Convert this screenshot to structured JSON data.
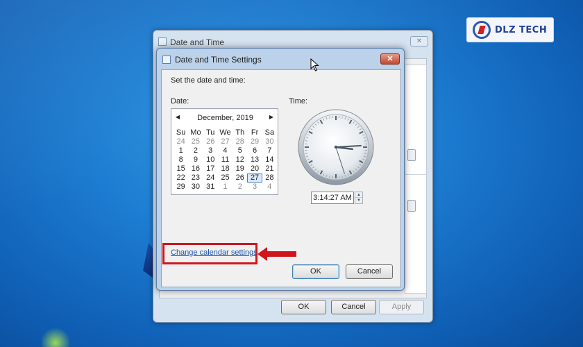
{
  "watermark": {
    "brand": "DLZ TECH"
  },
  "back_window": {
    "title": "Date and Time",
    "close_label": "✕",
    "ok_label": "OK",
    "cancel_label": "Cancel",
    "apply_label": "Apply"
  },
  "dialog": {
    "title": "Date and Time Settings",
    "close_label": "✕",
    "instruction": "Set the date and time:",
    "date_label": "Date:",
    "time_label": "Time:",
    "calendar": {
      "month_label": "December, 2019",
      "prev_icon": "◀",
      "next_icon": "▶",
      "weekdays": [
        "Su",
        "Mo",
        "Tu",
        "We",
        "Th",
        "Fr",
        "Sa"
      ],
      "days": [
        {
          "d": "24",
          "m": "other"
        },
        {
          "d": "25",
          "m": "other"
        },
        {
          "d": "26",
          "m": "other"
        },
        {
          "d": "27",
          "m": "other"
        },
        {
          "d": "28",
          "m": "other"
        },
        {
          "d": "29",
          "m": "other"
        },
        {
          "d": "30",
          "m": "other"
        },
        {
          "d": "1",
          "m": "cur"
        },
        {
          "d": "2",
          "m": "cur"
        },
        {
          "d": "3",
          "m": "cur"
        },
        {
          "d": "4",
          "m": "cur"
        },
        {
          "d": "5",
          "m": "cur"
        },
        {
          "d": "6",
          "m": "cur"
        },
        {
          "d": "7",
          "m": "cur"
        },
        {
          "d": "8",
          "m": "cur"
        },
        {
          "d": "9",
          "m": "cur"
        },
        {
          "d": "10",
          "m": "cur"
        },
        {
          "d": "11",
          "m": "cur"
        },
        {
          "d": "12",
          "m": "cur"
        },
        {
          "d": "13",
          "m": "cur"
        },
        {
          "d": "14",
          "m": "cur"
        },
        {
          "d": "15",
          "m": "cur"
        },
        {
          "d": "16",
          "m": "cur"
        },
        {
          "d": "17",
          "m": "cur"
        },
        {
          "d": "18",
          "m": "cur"
        },
        {
          "d": "19",
          "m": "cur"
        },
        {
          "d": "20",
          "m": "cur"
        },
        {
          "d": "21",
          "m": "cur"
        },
        {
          "d": "22",
          "m": "cur"
        },
        {
          "d": "23",
          "m": "cur"
        },
        {
          "d": "24",
          "m": "cur"
        },
        {
          "d": "25",
          "m": "cur"
        },
        {
          "d": "26",
          "m": "cur"
        },
        {
          "d": "27",
          "m": "sel"
        },
        {
          "d": "28",
          "m": "cur"
        },
        {
          "d": "29",
          "m": "cur"
        },
        {
          "d": "30",
          "m": "cur"
        },
        {
          "d": "31",
          "m": "cur"
        },
        {
          "d": "1",
          "m": "other"
        },
        {
          "d": "2",
          "m": "other"
        },
        {
          "d": "3",
          "m": "other"
        },
        {
          "d": "4",
          "m": "other"
        }
      ]
    },
    "time_value": "3:14:27 AM",
    "clock": {
      "hour": 3,
      "minute": 14,
      "second": 27
    },
    "calendar_link": "Change calendar settings",
    "ok_label": "OK",
    "cancel_label": "Cancel"
  },
  "colors": {
    "highlight": "#d0161c",
    "link": "#1a54a8",
    "desktop": "#1e7fd3"
  }
}
